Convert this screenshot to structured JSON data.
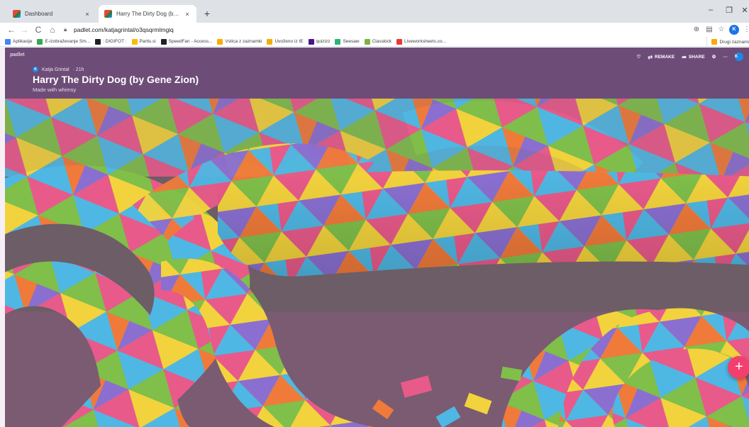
{
  "browser": {
    "tabs": [
      {
        "title": "Dashboard",
        "close": "×",
        "active": false
      },
      {
        "title": "Harry The Dirty Dog (by Gene Zi",
        "close": "×",
        "active": true
      }
    ],
    "new_tab": "+",
    "window_controls": {
      "minimize": "–",
      "restore": "❐",
      "close": "✕"
    },
    "url": "padlet.com/katjagrintal/o3qsqrmlmgiq",
    "nav": {
      "back": "←",
      "forward": "→",
      "reload": "C",
      "home": "⌂"
    }
  },
  "bookmarks": {
    "items": [
      {
        "label": "Aplikacije",
        "icon": "apps-grid-icon",
        "color": "#4285f4"
      },
      {
        "label": "E-izobraževanje Sm...",
        "icon": "bookmark-icon",
        "color": "#34a853"
      },
      {
        "label": ": DIGIFOT :",
        "icon": "bookmark-icon",
        "color": "#202124"
      },
      {
        "label": "Partis.si",
        "icon": "bookmark-icon",
        "color": "#fbbc04"
      },
      {
        "label": "SpeedFan - Access...",
        "icon": "bookmark-icon",
        "color": "#202124"
      },
      {
        "label": "Vstica z zaznamki",
        "icon": "folder-icon",
        "color": "#f9ab00"
      },
      {
        "label": "Uvoženo iz IE",
        "icon": "folder-icon",
        "color": "#f9ab00"
      },
      {
        "label": "quizizz",
        "icon": "bookmark-icon",
        "color": "#4a148c"
      },
      {
        "label": "Seesaw",
        "icon": "bookmark-icon",
        "color": "#2bb673"
      },
      {
        "label": "Classkick",
        "icon": "bookmark-icon",
        "color": "#7cb342"
      },
      {
        "label": "Liveworksheets.co...",
        "icon": "bookmark-icon",
        "color": "#e53935"
      }
    ],
    "other": "Drugi zaznami"
  },
  "padlet": {
    "logo": "padlet",
    "author": "Katja Grintal",
    "author_initial": "K",
    "time": "· 21h",
    "title": "Harry The Dirty Dog (by Gene Zion)",
    "description": "Made with whimsy",
    "actions": {
      "remake": "REMAKE",
      "share": "SHARE",
      "more": "···"
    },
    "profile_initial": "K",
    "fab": "+",
    "colors": {
      "header": "#6e4c78",
      "fab": "#f23f6e"
    }
  }
}
